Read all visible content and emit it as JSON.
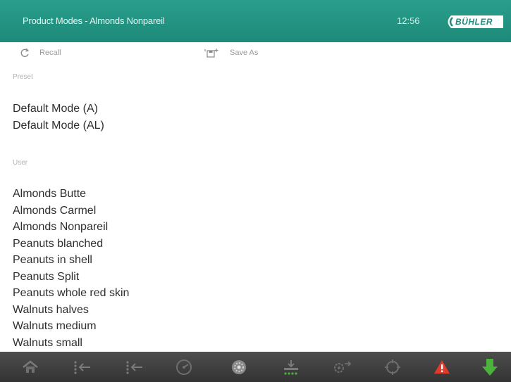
{
  "header": {
    "title": "Product Modes - Almonds Nonpareil",
    "time": "12:56",
    "brand": "BÜHLER"
  },
  "toolbar": {
    "recall_label": "Recall",
    "save_as_label": "Save As"
  },
  "preset": {
    "label": "Preset",
    "items": [
      "Default Mode (A)",
      "Default Mode (AL)"
    ]
  },
  "user": {
    "label": "User",
    "items": [
      "Almonds Butte",
      "Almonds Carmel",
      "Almonds Nonpareil",
      "Peanuts blanched",
      "Peanuts in shell",
      "Peanuts Split",
      "Peanuts whole red skin",
      "Walnuts halves",
      "Walnuts medium",
      "Walnuts small"
    ]
  },
  "footer": {
    "icons": [
      "home-icon",
      "eject-left-icon",
      "eject-left-alt-icon",
      "gauge-icon",
      "sorter-icon",
      "feed-icon",
      "settings-icon",
      "target-icon",
      "warning-icon",
      "download-icon"
    ]
  },
  "colors": {
    "header": "#2a9e8c",
    "footer": "#444444",
    "warning": "#e23a2a",
    "download": "#4bb33c"
  }
}
